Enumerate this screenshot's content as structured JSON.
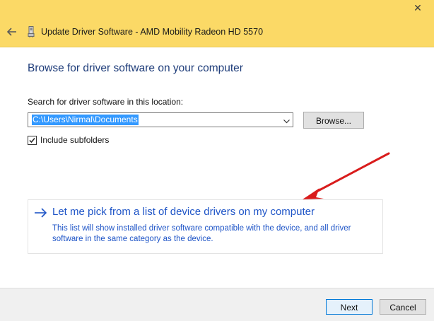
{
  "window": {
    "title": "Update Driver Software - AMD Mobility Radeon HD 5570",
    "close_glyph": "✕",
    "titlebar_color": "#fbd966"
  },
  "page": {
    "heading": "Browse for driver software on your computer",
    "search_label": "Search for driver software in this location:",
    "path_value": "C:\\Users\\Nirmal\\Documents",
    "browse_label": "Browse...",
    "include_subfolders_label": "Include subfolders",
    "include_subfolders_checked": true
  },
  "pick_option": {
    "title": "Let me pick from a list of device drivers on my computer",
    "description": "This list will show installed driver software compatible with the device, and all driver software in the same category as the device.",
    "link_color": "#1f55c7"
  },
  "footer": {
    "next_label": "Next",
    "cancel_label": "Cancel"
  },
  "icons": {
    "back": "back-arrow-icon",
    "device": "graphics-card-icon",
    "close": "close-icon",
    "dropdown": "chevron-down-icon",
    "option_arrow": "right-arrow-icon",
    "checkbox": "checkmark-icon"
  },
  "annotation": {
    "color": "#e02020"
  }
}
